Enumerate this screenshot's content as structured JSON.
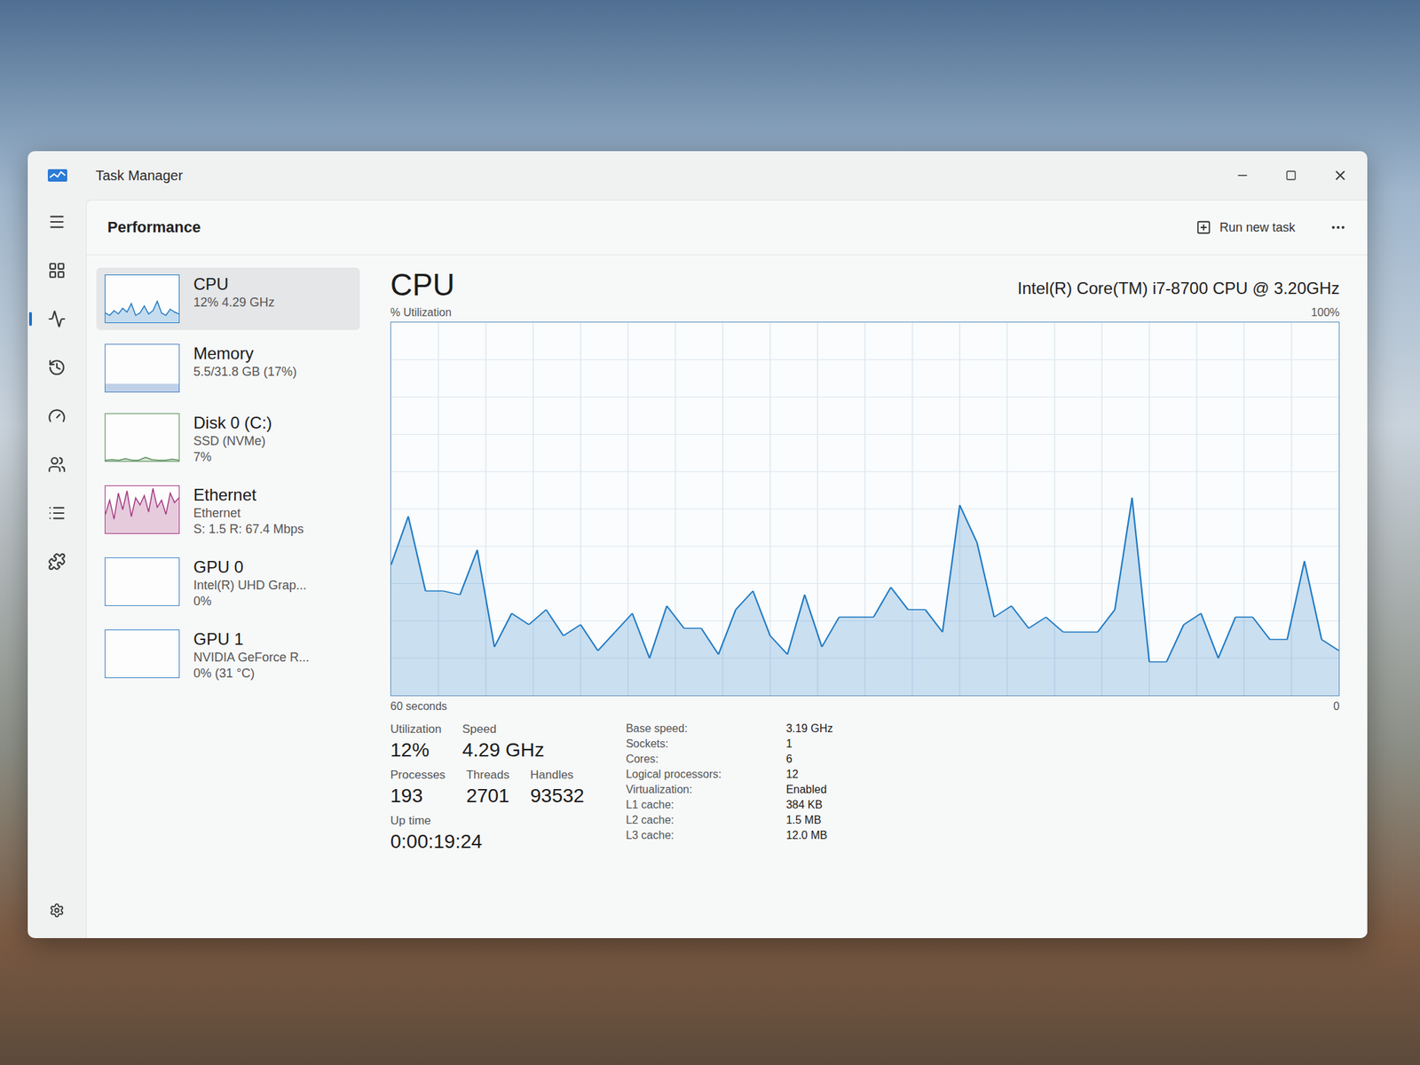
{
  "window": {
    "title": "Task Manager"
  },
  "page": {
    "title": "Performance",
    "run_new_task": "Run new task"
  },
  "sidebar": {
    "items": [
      {
        "name": "CPU",
        "lines": [
          "12% 4.29 GHz"
        ],
        "selected": true,
        "kind": "graph",
        "color": "#1f7ac4",
        "graph": [
          20,
          15,
          25,
          18,
          30,
          22,
          40,
          15,
          20,
          35,
          18,
          25,
          45,
          20,
          15,
          28,
          22,
          18
        ]
      },
      {
        "name": "Memory",
        "lines": [
          "5.5/31.8 GB (17%)"
        ],
        "selected": false,
        "kind": "fill",
        "color": "#4a7fc1",
        "level": 0.17
      },
      {
        "name": "Disk 0 (C:)",
        "lines": [
          "SSD (NVMe)",
          "7%"
        ],
        "selected": false,
        "kind": "graph",
        "color": "#5a8f5a",
        "graph": [
          2,
          3,
          2,
          5,
          2,
          2,
          8,
          3,
          2,
          2,
          4,
          2
        ]
      },
      {
        "name": "Ethernet",
        "lines": [
          "Ethernet",
          "S: 1.5 R: 67.4 Mbps"
        ],
        "selected": false,
        "kind": "graph",
        "color": "#a4377f",
        "graph": [
          40,
          70,
          30,
          85,
          50,
          90,
          35,
          75,
          60,
          80,
          45,
          95,
          55,
          70,
          40,
          85,
          65,
          75
        ]
      },
      {
        "name": "GPU 0",
        "lines": [
          "Intel(R) UHD Grap...",
          "0%"
        ],
        "selected": false,
        "kind": "fill",
        "color": "#3a7fc4",
        "level": 0
      },
      {
        "name": "GPU 1",
        "lines": [
          "NVIDIA GeForce R...",
          "0% (31 °C)"
        ],
        "selected": false,
        "kind": "fill",
        "color": "#3a7fc4",
        "level": 0
      }
    ]
  },
  "cpu": {
    "title": "CPU",
    "model": "Intel(R) Core(TM) i7-8700 CPU @ 3.20GHz",
    "chart": {
      "y_label": "% Utilization",
      "y_max_label": "100%",
      "x_label": "60 seconds",
      "x_end_label": "0",
      "max": 100,
      "series": [
        {
          "name": "Utilization",
          "color": "#1f7ac4",
          "values": [
            35,
            48,
            28,
            28,
            27,
            39,
            13,
            22,
            19,
            23,
            16,
            19,
            12,
            17,
            22,
            10,
            24,
            18,
            18,
            11,
            23,
            28,
            16,
            11,
            27,
            13,
            21,
            21,
            21,
            29,
            23,
            23,
            17,
            51,
            41,
            21,
            24,
            18,
            21,
            17,
            17,
            17,
            23,
            53,
            9,
            9,
            19,
            22,
            10,
            21,
            21,
            15,
            15,
            36,
            15,
            12
          ]
        }
      ]
    },
    "stats": [
      [
        {
          "label": "Utilization",
          "value": "12%"
        },
        {
          "label": "Speed",
          "value": "4.29 GHz"
        }
      ],
      [
        {
          "label": "Processes",
          "value": "193"
        },
        {
          "label": "Threads",
          "value": "2701"
        },
        {
          "label": "Handles",
          "value": "93532"
        }
      ],
      [
        {
          "label": "Up time",
          "value": "0:00:19:24"
        }
      ]
    ],
    "details": [
      {
        "label": "Base speed:",
        "value": "3.19 GHz"
      },
      {
        "label": "Sockets:",
        "value": "1"
      },
      {
        "label": "Cores:",
        "value": "6"
      },
      {
        "label": "Logical processors:",
        "value": "12"
      },
      {
        "label": "Virtualization:",
        "value": "Enabled"
      },
      {
        "label": "L1 cache:",
        "value": "384 KB"
      },
      {
        "label": "L2 cache:",
        "value": "1.5 MB"
      },
      {
        "label": "L3 cache:",
        "value": "12.0 MB"
      }
    ]
  }
}
